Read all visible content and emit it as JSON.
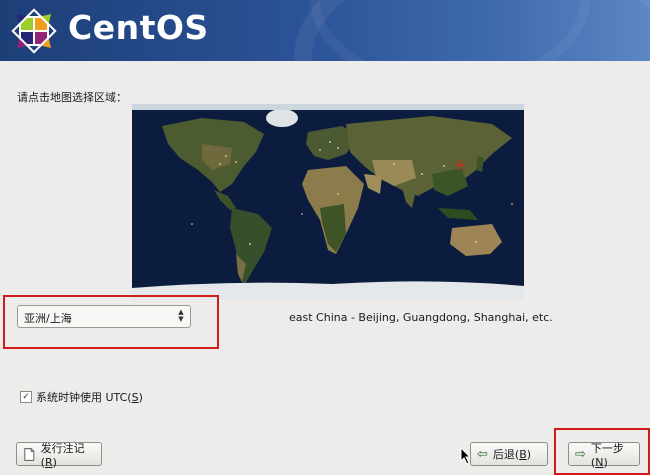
{
  "header": {
    "logo_text": "CentOS"
  },
  "prompt": "请点击地图选择区域：",
  "timezone": {
    "selected": "亚洲/上海",
    "description": "east China - Beijing, Guangdong, Shanghai, etc."
  },
  "utc_checkbox": {
    "label_prefix": "系统时钟使用 UTC(",
    "mnemonic": "S",
    "label_suffix": ")",
    "checked": true
  },
  "buttons": {
    "release_notes": {
      "prefix": "发行注记(",
      "mnemonic": "R",
      "suffix": ")"
    },
    "back": {
      "prefix": "后退(",
      "mnemonic": "B",
      "suffix": ")"
    },
    "next": {
      "prefix": "下一步(",
      "mnemonic": "N",
      "suffix": ")"
    }
  },
  "colors": {
    "header": "#2b5296",
    "highlight": "#d21c1c",
    "background": "#edeceb"
  }
}
